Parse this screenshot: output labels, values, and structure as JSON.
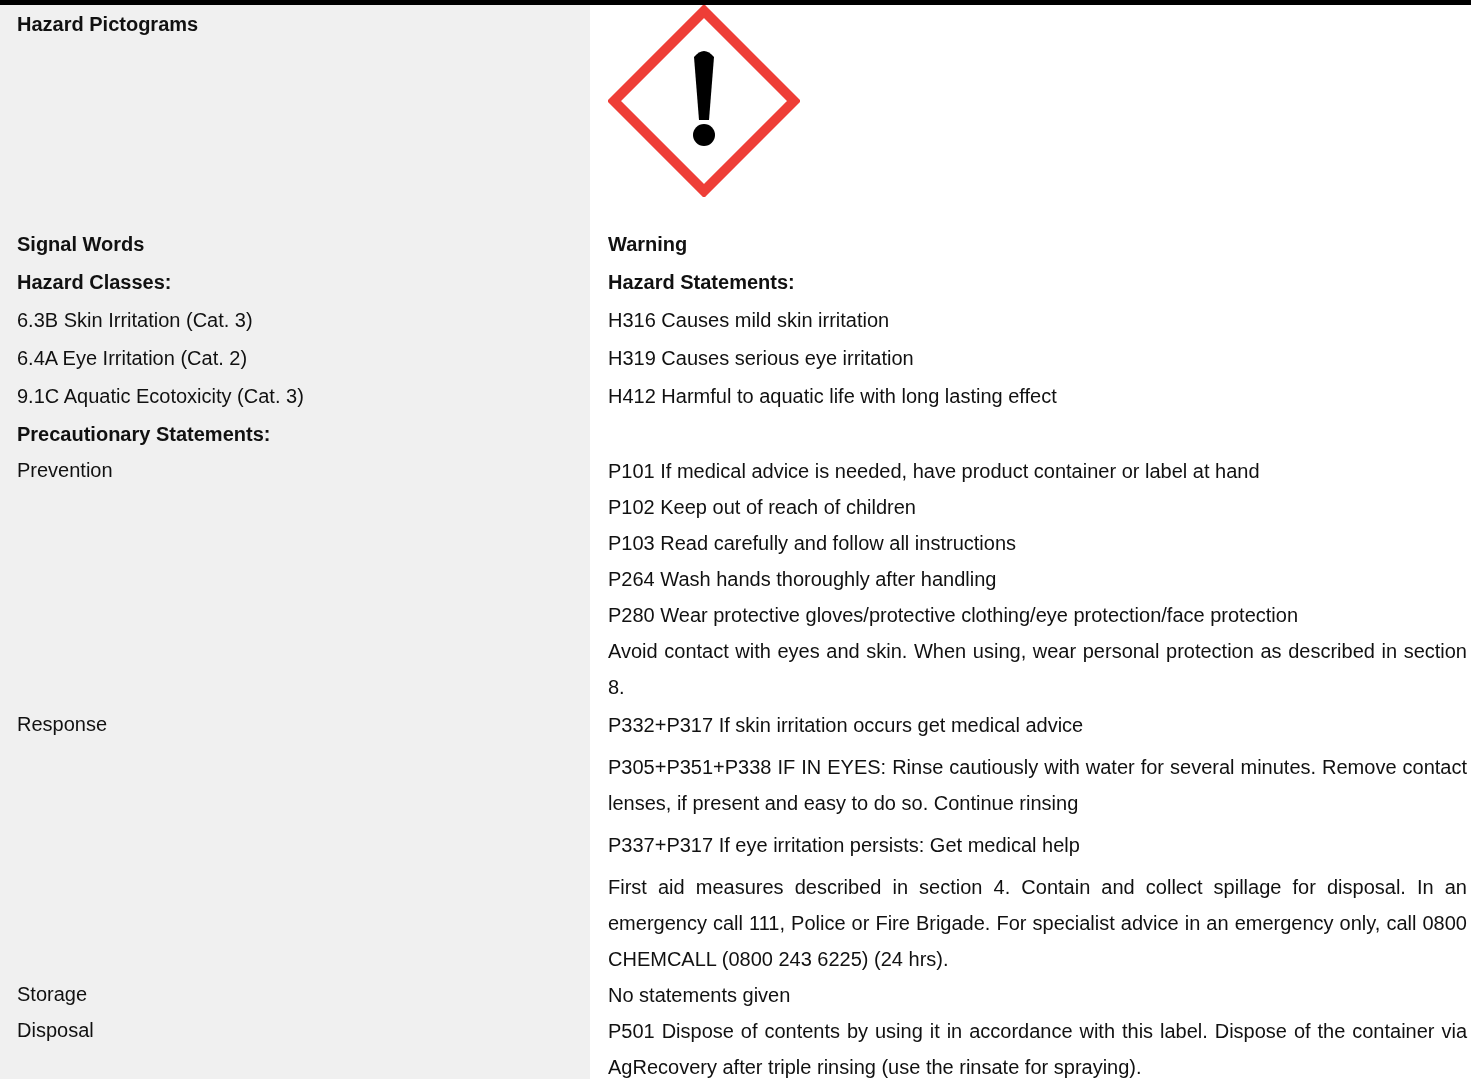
{
  "pictograms": {
    "label": "Hazard Pictograms"
  },
  "signal": {
    "label": "Signal Words",
    "value": "Warning"
  },
  "classes_header": {
    "label": "Hazard Classes:",
    "value": "Hazard Statements:"
  },
  "classes": [
    {
      "hazard_class": "6.3B Skin Irritation (Cat. 3)",
      "statement": "H316 Causes mild skin irritation"
    },
    {
      "hazard_class": "6.4A Eye Irritation (Cat. 2)",
      "statement": "H319 Causes serious eye irritation"
    },
    {
      "hazard_class": "9.1C Aquatic Ecotoxicity (Cat. 3)",
      "statement": "H412 Harmful to aquatic life with long lasting effect"
    }
  ],
  "precautionary_header": "Precautionary Statements:",
  "precautionary": [
    {
      "label": "Prevention",
      "statements": [
        "P101 If medical advice is needed, have product container or label at hand",
        "P102 Keep out of reach of children",
        "P103 Read carefully and follow all instructions",
        "P264 Wash hands thoroughly after handling",
        "P280 Wear protective gloves/protective clothing/eye protection/face protection",
        "Avoid contact with eyes and skin. When using, wear personal protection as described in section 8."
      ]
    },
    {
      "label": "Response",
      "statements": [
        "P332+P317 If skin irritation occurs get medical advice",
        "P305+P351+P338 IF IN EYES: Rinse cautiously with water for several minutes. Remove contact lenses, if present and easy to do so. Continue rinsing",
        "P337+P317 If eye irritation persists: Get medical help",
        "First aid measures described in section 4. Contain and collect spillage for disposal. In an emergency call 111, Police or Fire Brigade. For specialist advice in an emergency only, call 0800 CHEMCALL (0800 243 6225) (24 hrs)."
      ]
    },
    {
      "label": "Storage",
      "statements": [
        "No statements given"
      ]
    },
    {
      "label": "Disposal",
      "statements": [
        "P501 Dispose of contents by using it in accordance with this label. Dispose of the container via AgRecovery after triple rinsing (use the rinsate for spraying)."
      ]
    }
  ]
}
